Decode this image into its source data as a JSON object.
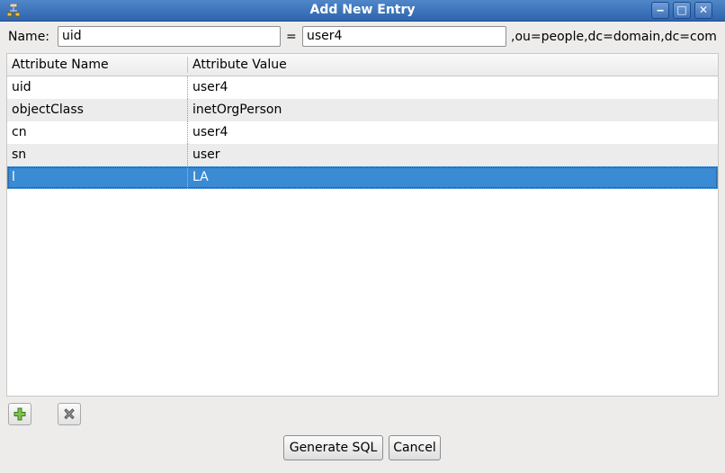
{
  "window": {
    "title": "Add New Entry"
  },
  "form": {
    "name_label": "Name:",
    "rdn_attribute": "uid",
    "equals": "=",
    "rdn_value": "user4",
    "dn_suffix": ",ou=people,dc=domain,dc=com"
  },
  "table": {
    "headers": [
      "Attribute Name",
      "Attribute Value"
    ],
    "rows": [
      {
        "name": "uid",
        "value": "user4"
      },
      {
        "name": "objectClass",
        "value": "inetOrgPerson"
      },
      {
        "name": "cn",
        "value": "user4"
      },
      {
        "name": "sn",
        "value": "user"
      },
      {
        "name": "l",
        "value": "LA"
      }
    ],
    "selected_row": 4
  },
  "icons": {
    "add": "plus-icon",
    "remove": "delete-icon",
    "window_min": "minimize-icon",
    "window_max": "maximize-icon",
    "window_close": "close-icon",
    "app": "network-icon"
  },
  "buttons": {
    "generate": "Generate SQL",
    "cancel": "Cancel"
  },
  "colors": {
    "titlebar": "#3a6fb6",
    "selection": "#3a8ad4",
    "add_icon": "#6db33f"
  }
}
